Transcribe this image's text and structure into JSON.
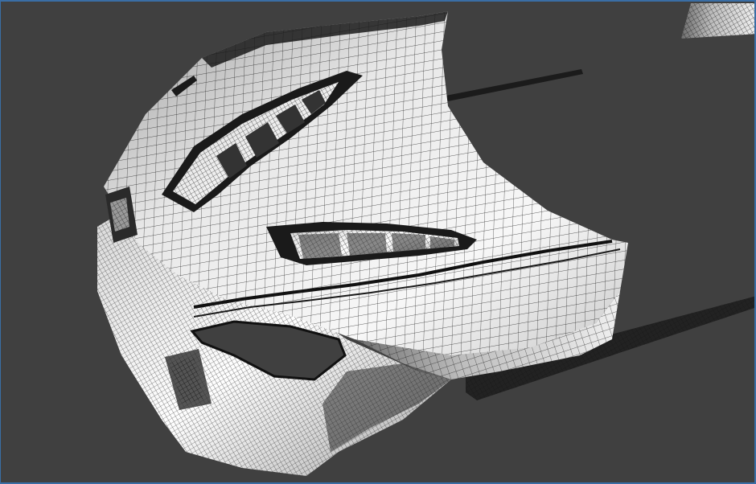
{
  "viewport": {
    "background": "#404040",
    "frame_color": "#3a6ea5",
    "render_mode": "wireframe-on-shaded",
    "model_icon": "car-front-body-mesh"
  },
  "mesh": {
    "surface_light": "#f2f2f2",
    "surface_shade": "#8c8c8c",
    "wire_color": "#111111"
  }
}
